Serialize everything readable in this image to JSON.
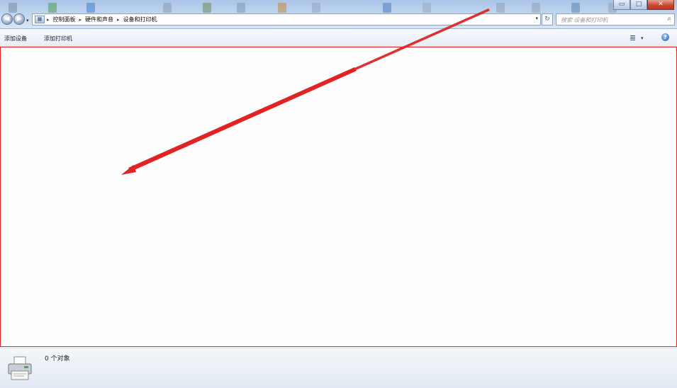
{
  "window": {
    "controls": {
      "minimize": "▭",
      "maximize": "□",
      "close": "✕"
    }
  },
  "navigation": {
    "back_icon": "back-arrow-icon",
    "forward_icon": "forward-arrow-icon"
  },
  "address_bar": {
    "breadcrumbs": [
      "控制面板",
      "硬件和声音",
      "设备和打印机"
    ],
    "separator": "▸"
  },
  "search": {
    "placeholder": "搜索 设备和打印机",
    "icon": "search-icon"
  },
  "toolbar": {
    "add_device": "添加设备",
    "add_printer": "添加打印机"
  },
  "content": {
    "items": [],
    "annotation_color": "#e02424"
  },
  "details_pane": {
    "count_text": "0 个对象",
    "icon": "printer-icon"
  },
  "colors": {
    "titlebar": "#c4d8f0",
    "annotation": "#e02424"
  }
}
